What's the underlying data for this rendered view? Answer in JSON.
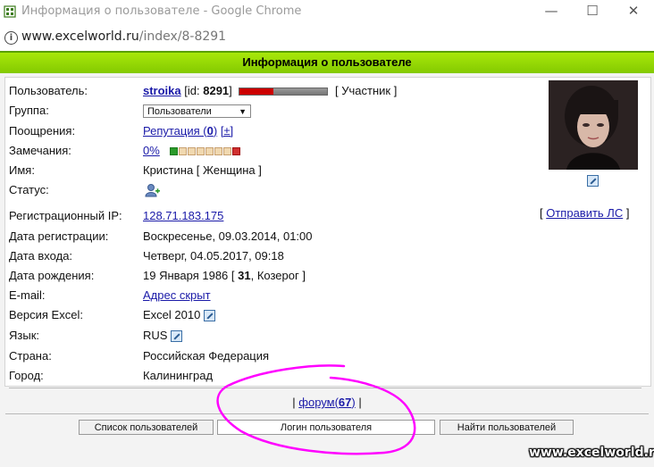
{
  "window": {
    "title": "Информация о пользователе - Google Chrome",
    "minimize": "—",
    "maximize": "☐",
    "close": "✕"
  },
  "address": {
    "domain": "www.excelworld.ru",
    "path": "/index/8-8291"
  },
  "header": {
    "title": "Информация о пользователе"
  },
  "user": {
    "label": "Пользователь:",
    "name": "stroika",
    "id_prefix": "[id: ",
    "id": "8291",
    "id_suffix": "]",
    "role": "[ Участник ]",
    "rank_fraction": 0.38
  },
  "group": {
    "label": "Группа:",
    "value": "Пользователи"
  },
  "rewards": {
    "label": "Поощрения:",
    "link_prefix": "Репутация (",
    "count": "0",
    "link_suffix": ")",
    "plus": "[±]"
  },
  "warnings": {
    "label": "Замечания:",
    "value": "0%"
  },
  "name": {
    "label": "Имя:",
    "value": "Кристина [ Женщина ]"
  },
  "status": {
    "label": "Статус:"
  },
  "reg_ip": {
    "label": "Регистрационный IP:",
    "value": "128.71.183.175"
  },
  "send_pm": {
    "open": "[ ",
    "link": "Отправить ЛС",
    "close": " ]"
  },
  "reg_date": {
    "label": "Дата регистрации:",
    "value": "Воскресенье, 09.03.2014, 01:00"
  },
  "login_date": {
    "label": "Дата входа:",
    "value": "Четверг, 04.05.2017, 09:18"
  },
  "birthday": {
    "label": "Дата рождения:",
    "prefix": "19 Января 1986 [ ",
    "age": "31",
    "suffix": ", Козерог ]"
  },
  "email": {
    "label": "E-mail:",
    "value": "Адрес скрыт"
  },
  "excel": {
    "label": "Версия Excel:",
    "value": "Excel 2010"
  },
  "language": {
    "label": "Язык:",
    "value": "RUS"
  },
  "country": {
    "label": "Страна:",
    "value": "Российская Федерация"
  },
  "city": {
    "label": "Город:",
    "value": "Калининград"
  },
  "forum": {
    "left": "|",
    "link": "форум",
    "open": "(",
    "count": "67",
    "close": ")",
    "right": "|"
  },
  "buttons": {
    "users_list": "Список пользователей",
    "login_input": "Логин пользователя",
    "find_users": "Найти пользователей"
  },
  "watermark": "www.excelworld.ru",
  "colors": {
    "header_green": "#8fd400",
    "link_blue": "#1a1aa8",
    "annotation_magenta": "#ff00ff"
  }
}
